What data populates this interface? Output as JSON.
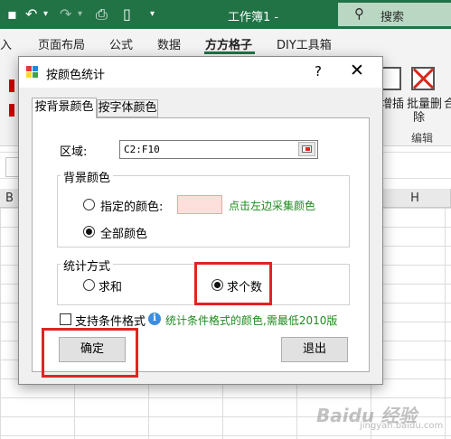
{
  "excel": {
    "window_title": "工作簿1 -",
    "search_label": "搜索",
    "ribbon_tabs": [
      "入",
      "页面布局",
      "公式",
      "数据",
      "方方格子",
      "DIY工具箱"
    ],
    "active_tab": "方方格子",
    "ribbon_buttons": {
      "insert_label": "增插",
      "delete_label": "批量删",
      "delete_label_2": "除",
      "partial_label": "合"
    },
    "group_label": "编辑",
    "columns": [
      "B",
      "H"
    ],
    "watermark": "Baidu 经验",
    "watermark_sub": "jingyan.baidu.com"
  },
  "dialog": {
    "title": "按颜色统计",
    "help_glyph": "?",
    "close_glyph": "✕",
    "tabs": [
      {
        "label": "按背景颜色",
        "selected": true
      },
      {
        "label": "按字体颜色",
        "selected": false
      }
    ],
    "range_label": "区域:",
    "range_value": "C2:F10",
    "bg_group": {
      "title": "背景颜色",
      "option_specified": "指定的颜色:",
      "option_all": "全部颜色",
      "selected": "全部颜色",
      "pick_hint": "点击左边采集颜色",
      "swatch_color": "#fde0dc"
    },
    "stat_group": {
      "title": "统计方式",
      "option_sum": "求和",
      "option_count": "求个数",
      "selected": "求个数"
    },
    "conditional_format": {
      "label": "支持条件格式",
      "checked": false,
      "info_glyph": "i",
      "note": "统计条件格式的颜色,需最低2010版"
    },
    "ok_label": "确定",
    "exit_label": "退出"
  },
  "colors": {
    "excel_green": "#217346",
    "highlight_red": "#e02424",
    "hint_green": "#1e8a1e"
  }
}
